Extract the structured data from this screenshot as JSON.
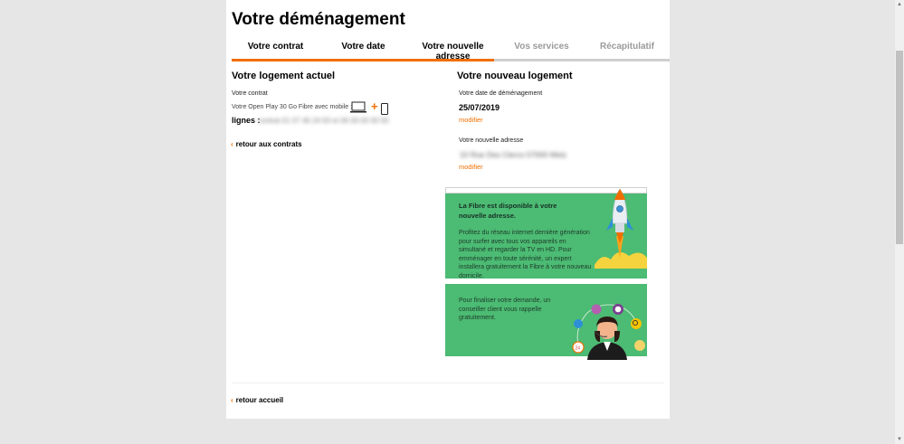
{
  "page": {
    "title": "Votre déménagement"
  },
  "tabs": [
    {
      "label": "Votre contrat",
      "state": "done"
    },
    {
      "label": "Votre date",
      "state": "done"
    },
    {
      "label": "Votre nouvelle adresse",
      "state": "active"
    },
    {
      "label": "Vos services",
      "state": "todo"
    },
    {
      "label": "Récapitulatif",
      "state": "todo"
    }
  ],
  "progress": {
    "fraction": 0.6,
    "color": "#f16e00"
  },
  "current_home": {
    "heading": "Votre logement actuel",
    "contract_label": "Votre contrat",
    "contract_text": "Votre Open Play 30 Go Fibre avec mobile :",
    "lines_label": "lignes :",
    "lines_blurred": "contrat 01 07 46 24 63 et 06 00 00 00 00",
    "back_link": "retour aux contrats"
  },
  "new_home": {
    "heading": "Votre nouveau logement",
    "date_label": "Votre date de déménagement",
    "date_value": "25/07/2019",
    "date_modify": "modifier",
    "address_label": "Votre nouvelle adresse",
    "address_blurred": "10 Rue Des Clercs 57000 Metz",
    "address_modify": "modifier"
  },
  "promo_fibre": {
    "heading": "La Fibre est disponible à votre nouvelle adresse.",
    "body": "Profitez du réseau internet dernière génération pour surfer avec tous vos appareils en simultané et regarder la TV en HD. Pour emménager en toute sérénité, un expert installera gratuitement la Fibre à votre nouveau domicile."
  },
  "promo_callback": {
    "body": "Pour finaliser votre demande, un conseiller client vous rappelle gratuitement."
  },
  "footer": {
    "back_home": "retour accueil"
  },
  "icons": {
    "laptop": "laptop-icon",
    "plus": "plus-icon",
    "phone": "smartphone-icon",
    "rocket": "rocket-icon",
    "advisor": "advisor-icon",
    "chevron": "chevron-left-icon"
  },
  "colors": {
    "accent": "#f16e00",
    "promo_green": "#4cbb73",
    "background": "#e6e6e6"
  }
}
